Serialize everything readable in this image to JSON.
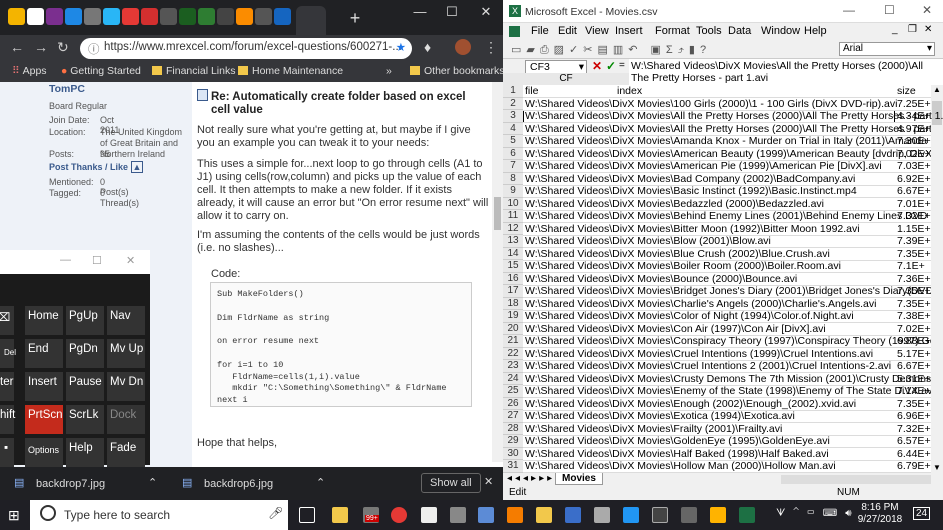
{
  "browser": {
    "url": "https://www.mrexcel.com/forum/excel-questions/600271-...",
    "bookmarks": [
      "Apps",
      "Getting Started",
      "Financial Links",
      "Home Maintenance",
      "»",
      "Other bookmarks"
    ]
  },
  "forum": {
    "username": "TomPC",
    "user_role": "Board Regular",
    "profile": [
      {
        "k": "Join Date:",
        "v": "Oct 2011"
      },
      {
        "k": "Location:",
        "v": "The United Kingdom of Great Britain and Northern Ireland"
      },
      {
        "k": "Posts:",
        "v": "95"
      }
    ],
    "post_thanks": "Post Thanks / Like",
    "mentioned": {
      "k": "Mentioned:",
      "v": "0 Post(s)"
    },
    "tagged": {
      "k": "Tagged:",
      "v": "0 Thread(s)"
    },
    "post_title": "Re: Automatically create folder based on excel cell value",
    "p1": "Not really sure what you're getting at, but maybe if I give you an example you can tweak it to your needs:",
    "p2": "This uses a simple for...next loop to go through cells (A1 to J1) using cells(row,column) and picks up the value of each cell. It then attempts to make a new folder. If it exists already, it will cause an error but \"On error resume next\" will allow it to carry on.",
    "p3": "I'm assuming the contents of the cells would be just words (i.e. no slashes)...",
    "code_label": "Code:",
    "code": "Sub MakeFolders()\n\nDim FldrName as string\n\non error resume next\n\nfor i=1 to 10\n   FldrName=cells(1,i).value\n   mkdir \"C:\\Something\\Something\\\" & FldrName\nnext i\n\nEnd Sub",
    "closing": "Hope that helps,"
  },
  "keyboard": {
    "keys": [
      "Home",
      "PgUp",
      "Nav",
      "Del",
      "End",
      "PgDn",
      "Mv Up",
      "ter",
      "Insert",
      "Pause",
      "Mv Dn",
      "hift",
      "PrtScn",
      "ScrLk",
      "Dock",
      "Options",
      "Help",
      "Fade"
    ]
  },
  "downloads": {
    "items": [
      "backdrop7.jpg",
      "backdrop6.jpg"
    ],
    "show_all": "Show all"
  },
  "excel": {
    "title": "Microsoft Excel - Movies.csv",
    "menus": [
      "File",
      "Edit",
      "View",
      "Insert",
      "Format",
      "Tools",
      "Data",
      "Window",
      "Help"
    ],
    "font": "Arial",
    "name_box": "CF3",
    "formula": "W:\\Shared Videos\\DivX Movies\\All the Pretty Horses (2000)\\All The Pretty Horses - part 1.avi",
    "col_header": "CF",
    "headers": [
      "file",
      "index",
      "size"
    ],
    "rows": [
      [
        "W:\\Shared Videos\\DivX Movies\\100 Girls (2000)\\1 - 100 Girls (DivX DVD-rip).avi",
        "",
        "7.25E+"
      ],
      [
        "W:\\Shared Videos\\DivX Movies\\All the Pretty Horses (2000)\\All The Pretty Horses - part 1.avi",
        "",
        "4.34E+"
      ],
      [
        "W:\\Shared Videos\\DivX Movies\\All the Pretty Horses (2000)\\All The Pretty Horses - part",
        "",
        "4.97E+"
      ],
      [
        "W:\\Shared Videos\\DivX Movies\\Amanda Knox - Murder on Trial in Italy (2011)\\Amanda",
        "",
        "7.30E+"
      ],
      [
        "W:\\Shared Videos\\DivX Movies\\American Beauty (1999)\\American Beauty [dvdrip, DivX]",
        "",
        "7.02E+"
      ],
      [
        "W:\\Shared Videos\\DivX Movies\\American Pie (1999)\\American Pie [DivX].avi",
        "",
        "7.03E+"
      ],
      [
        "W:\\Shared Videos\\DivX Movies\\Bad Company (2002)\\BadCompany.avi",
        "",
        "6.92E+"
      ],
      [
        "W:\\Shared Videos\\DivX Movies\\Basic Instinct (1992)\\Basic.Instinct.mp4",
        "",
        "6.67E+"
      ],
      [
        "W:\\Shared Videos\\DivX Movies\\Bedazzled (2000)\\Bedazzled.avi",
        "",
        "7.01E+"
      ],
      [
        "W:\\Shared Videos\\DivX Movies\\Behind Enemy Lines (2001)\\Behind Enemy Lines   DVD",
        "",
        "7.32E+"
      ],
      [
        "W:\\Shared Videos\\DivX Movies\\Bitter Moon (1992)\\Bitter Moon 1992.avi",
        "",
        "1.15E+"
      ],
      [
        "W:\\Shared Videos\\DivX Movies\\Blow (2001)\\Blow.avi",
        "",
        "7.39E+"
      ],
      [
        "W:\\Shared Videos\\DivX Movies\\Blue Crush (2002)\\Blue.Crush.avi",
        "",
        "7.35E+"
      ],
      [
        "W:\\Shared Videos\\DivX Movies\\Boiler Room (2000)\\Boiler.Room.avi",
        "",
        "7.1E+"
      ],
      [
        "W:\\Shared Videos\\DivX Movies\\Bounce (2000)\\Bounce.avi",
        "",
        "7.36E+"
      ],
      [
        "W:\\Shared Videos\\DivX Movies\\Bridget Jones's Diary (2001)\\Bridget Jones's Diary(DVD",
        "",
        "7.35E+"
      ],
      [
        "W:\\Shared Videos\\DivX Movies\\Charlie's Angels (2000)\\Charlie's.Angels.avi",
        "",
        "7.35E+"
      ],
      [
        "W:\\Shared Videos\\DivX Movies\\Color of Night (1994)\\Color.of.Night.avi",
        "",
        "7.38E+"
      ],
      [
        "W:\\Shared Videos\\DivX Movies\\Con Air (1997)\\Con Air [DivX].avi",
        "",
        "7.02E+"
      ],
      [
        "W:\\Shared Videos\\DivX Movies\\Conspiracy Theory (1997)\\Conspiracy Theory (1997).Go",
        "",
        "6.88E+"
      ],
      [
        "W:\\Shared Videos\\DivX Movies\\Cruel Intentions (1999)\\Cruel Intentions.avi",
        "",
        "5.17E+"
      ],
      [
        "W:\\Shared Videos\\DivX Movies\\Cruel Intentions 2 (2001)\\Cruel Intentions-2.avi",
        "",
        "6.67E+"
      ],
      [
        "W:\\Shared Videos\\DivX Movies\\Crusty Demons The 7th Mission (2001)\\Crusty Demons",
        "",
        "5.31E+"
      ],
      [
        "W:\\Shared Videos\\DivX Movies\\Enemy of the State (1998)\\Enemy of The State DiVX.av",
        "",
        "7.14E+"
      ],
      [
        "W:\\Shared Videos\\DivX Movies\\Enough (2002)\\Enough_(2002).xvid.avi",
        "",
        "7.35E+"
      ],
      [
        "W:\\Shared Videos\\DivX Movies\\Exotica (1994)\\Exotica.avi",
        "",
        "6.96E+"
      ],
      [
        "W:\\Shared Videos\\DivX Movies\\Frailty (2001)\\Frailty.avi",
        "",
        "7.32E+"
      ],
      [
        "W:\\Shared Videos\\DivX Movies\\GoldenEye (1995)\\GoldenEye.avi",
        "",
        "6.57E+"
      ],
      [
        "W:\\Shared Videos\\DivX Movies\\Half Baked (1998)\\Half Baked.avi",
        "",
        "6.44E+"
      ],
      [
        "W:\\Shared Videos\\DivX Movies\\Hollow Man (2000)\\Hollow Man.avi",
        "",
        "6.79E+"
      ]
    ],
    "sheet_tab": "Movies",
    "status_left": "Edit",
    "status_num": "NUM"
  },
  "taskbar": {
    "search_placeholder": "Type here to search",
    "badge": "99+",
    "time": "8:16 PM",
    "date": "9/27/2018",
    "notif": "24"
  }
}
